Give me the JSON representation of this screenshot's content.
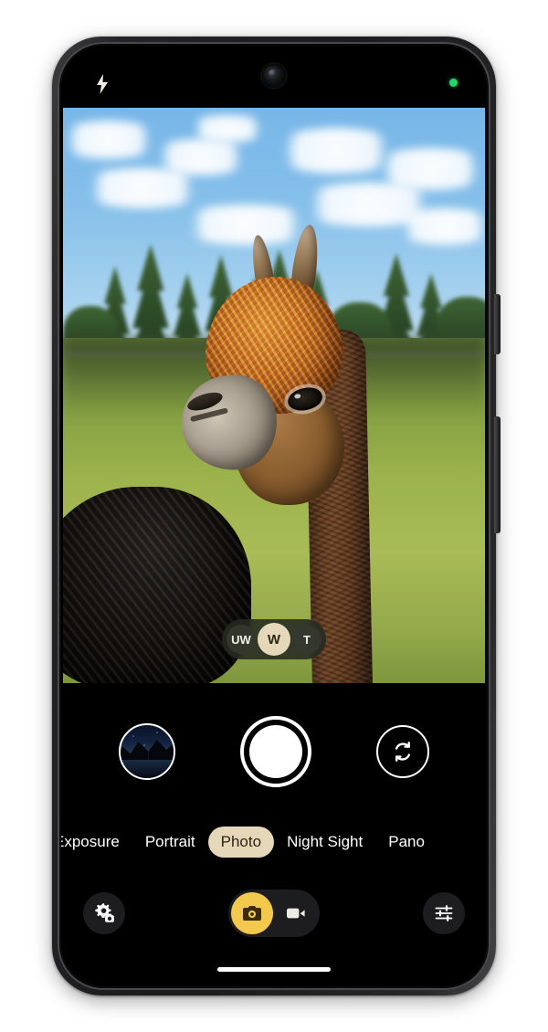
{
  "device": {
    "name": "android-phone",
    "status_bar": {
      "flash_icon": "flash-icon",
      "front_camera": "front-camera-lens",
      "privacy_indicator": "camera-in-use-dot",
      "privacy_color": "#25d366"
    }
  },
  "viewfinder": {
    "label": "camera-preview",
    "scene": "Brown alpaca head in profile with a black alpaca behind, green grass field, blurred conifer treeline and blue sky with white clouds",
    "zoom_selector": {
      "options": [
        {
          "label": "UW",
          "name": "zoom-ultrawide",
          "active": false
        },
        {
          "label": "W",
          "name": "zoom-wide",
          "active": true
        },
        {
          "label": "T",
          "name": "zoom-telephoto",
          "active": false
        }
      ],
      "active_color": "#e5d8b8"
    }
  },
  "controls": {
    "gallery_thumbnail": "gallery-thumbnail",
    "shutter": "shutter-button",
    "flip_camera": "flip-camera-button"
  },
  "modes": [
    {
      "label": "Exposure",
      "active": false,
      "truncated": true
    },
    {
      "label": "Portrait",
      "active": false,
      "truncated": false
    },
    {
      "label": "Photo",
      "active": true,
      "truncated": false
    },
    {
      "label": "Night Sight",
      "active": false,
      "truncated": false
    },
    {
      "label": "Pano",
      "active": false,
      "truncated": true
    }
  ],
  "bottom_bar": {
    "settings_button": "camera-settings-button",
    "photo_toggle": {
      "name": "photo-mode-toggle",
      "active": true
    },
    "video_toggle": {
      "name": "video-mode-toggle",
      "active": false
    },
    "tune_button": "camera-tune-button",
    "accent_color": "#f2c94c"
  },
  "colors": {
    "mode_pill": "#e5d8b8",
    "mode_pill_text": "#2d2616",
    "zoom_pill_bg": "rgba(38,42,34,.88)",
    "accent_yellow": "#f2c94c"
  }
}
